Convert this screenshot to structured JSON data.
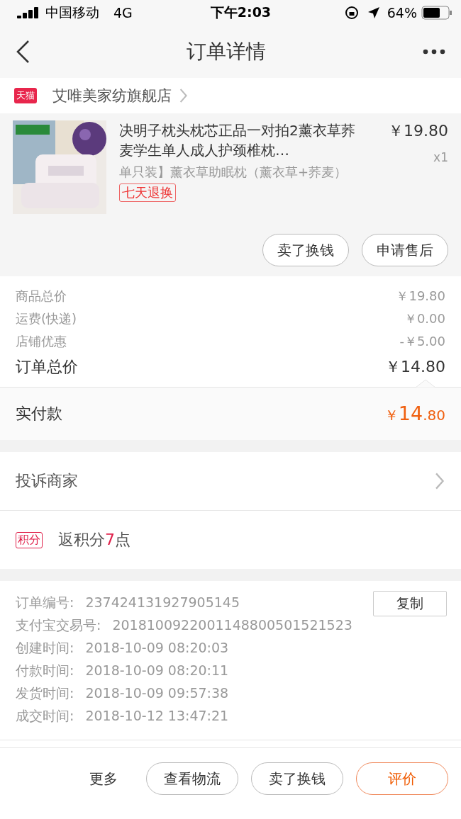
{
  "status_bar": {
    "carrier": "中国移动",
    "network": "4G",
    "time": "下午2:03",
    "battery": "64%"
  },
  "nav": {
    "title": "订单详情"
  },
  "store": {
    "badge": "天猫",
    "name": "艾唯美家纺旗舰店"
  },
  "product": {
    "image": {
      "kind": "picture"
    },
    "title": "决明子枕头枕芯正品一对拍2薰衣草荞麦学生单人成人护颈椎枕…",
    "spec": "单只装】薰衣草助眠枕（薰衣草+荞麦）",
    "tag": "七天退换",
    "price": "￥19.80",
    "quantity": "x1",
    "actions": [
      "卖了换钱",
      "申请售后"
    ]
  },
  "fees": [
    {
      "kind": "normal",
      "label": "商品总价",
      "value": "￥19.80"
    },
    {
      "kind": "normal",
      "label": "运费(快递)",
      "value": "￥0.00"
    },
    {
      "kind": "normal",
      "label": "店铺优惠",
      "value": "-￥5.00"
    },
    {
      "kind": "total",
      "label": "订单总价",
      "value": "￥14.80"
    }
  ],
  "paid": {
    "label": "实付款",
    "currency": "￥",
    "integer": "14",
    "decimal": ".80"
  },
  "complaint": {
    "label": "投诉商家"
  },
  "points": {
    "badge": "积分",
    "parts": [
      {
        "kind": "plain",
        "text": "返积分"
      },
      {
        "kind": "highlight",
        "text": "7"
      },
      {
        "kind": "plain",
        "text": "点"
      }
    ]
  },
  "info": {
    "copy_button": "复制",
    "rows": [
      {
        "label": "订单编号:",
        "value": "237424131927905145"
      },
      {
        "label": "支付宝交易号:",
        "value": "2018100922001148800501521523"
      },
      {
        "label": "创建时间:",
        "value": "2018-10-09 08:20:03"
      },
      {
        "label": "付款时间:",
        "value": "2018-10-09 08:20:11"
      },
      {
        "label": "发货时间:",
        "value": "2018-10-09 09:57:38"
      },
      {
        "label": "成交时间:",
        "value": "2018-10-12 13:47:21"
      }
    ]
  },
  "bottom_bar": [
    {
      "kind": "plain",
      "label": "更多"
    },
    {
      "kind": "outline",
      "label": "查看物流"
    },
    {
      "kind": "outline",
      "label": "卖了换钱"
    },
    {
      "kind": "primary",
      "label": "评价"
    }
  ]
}
